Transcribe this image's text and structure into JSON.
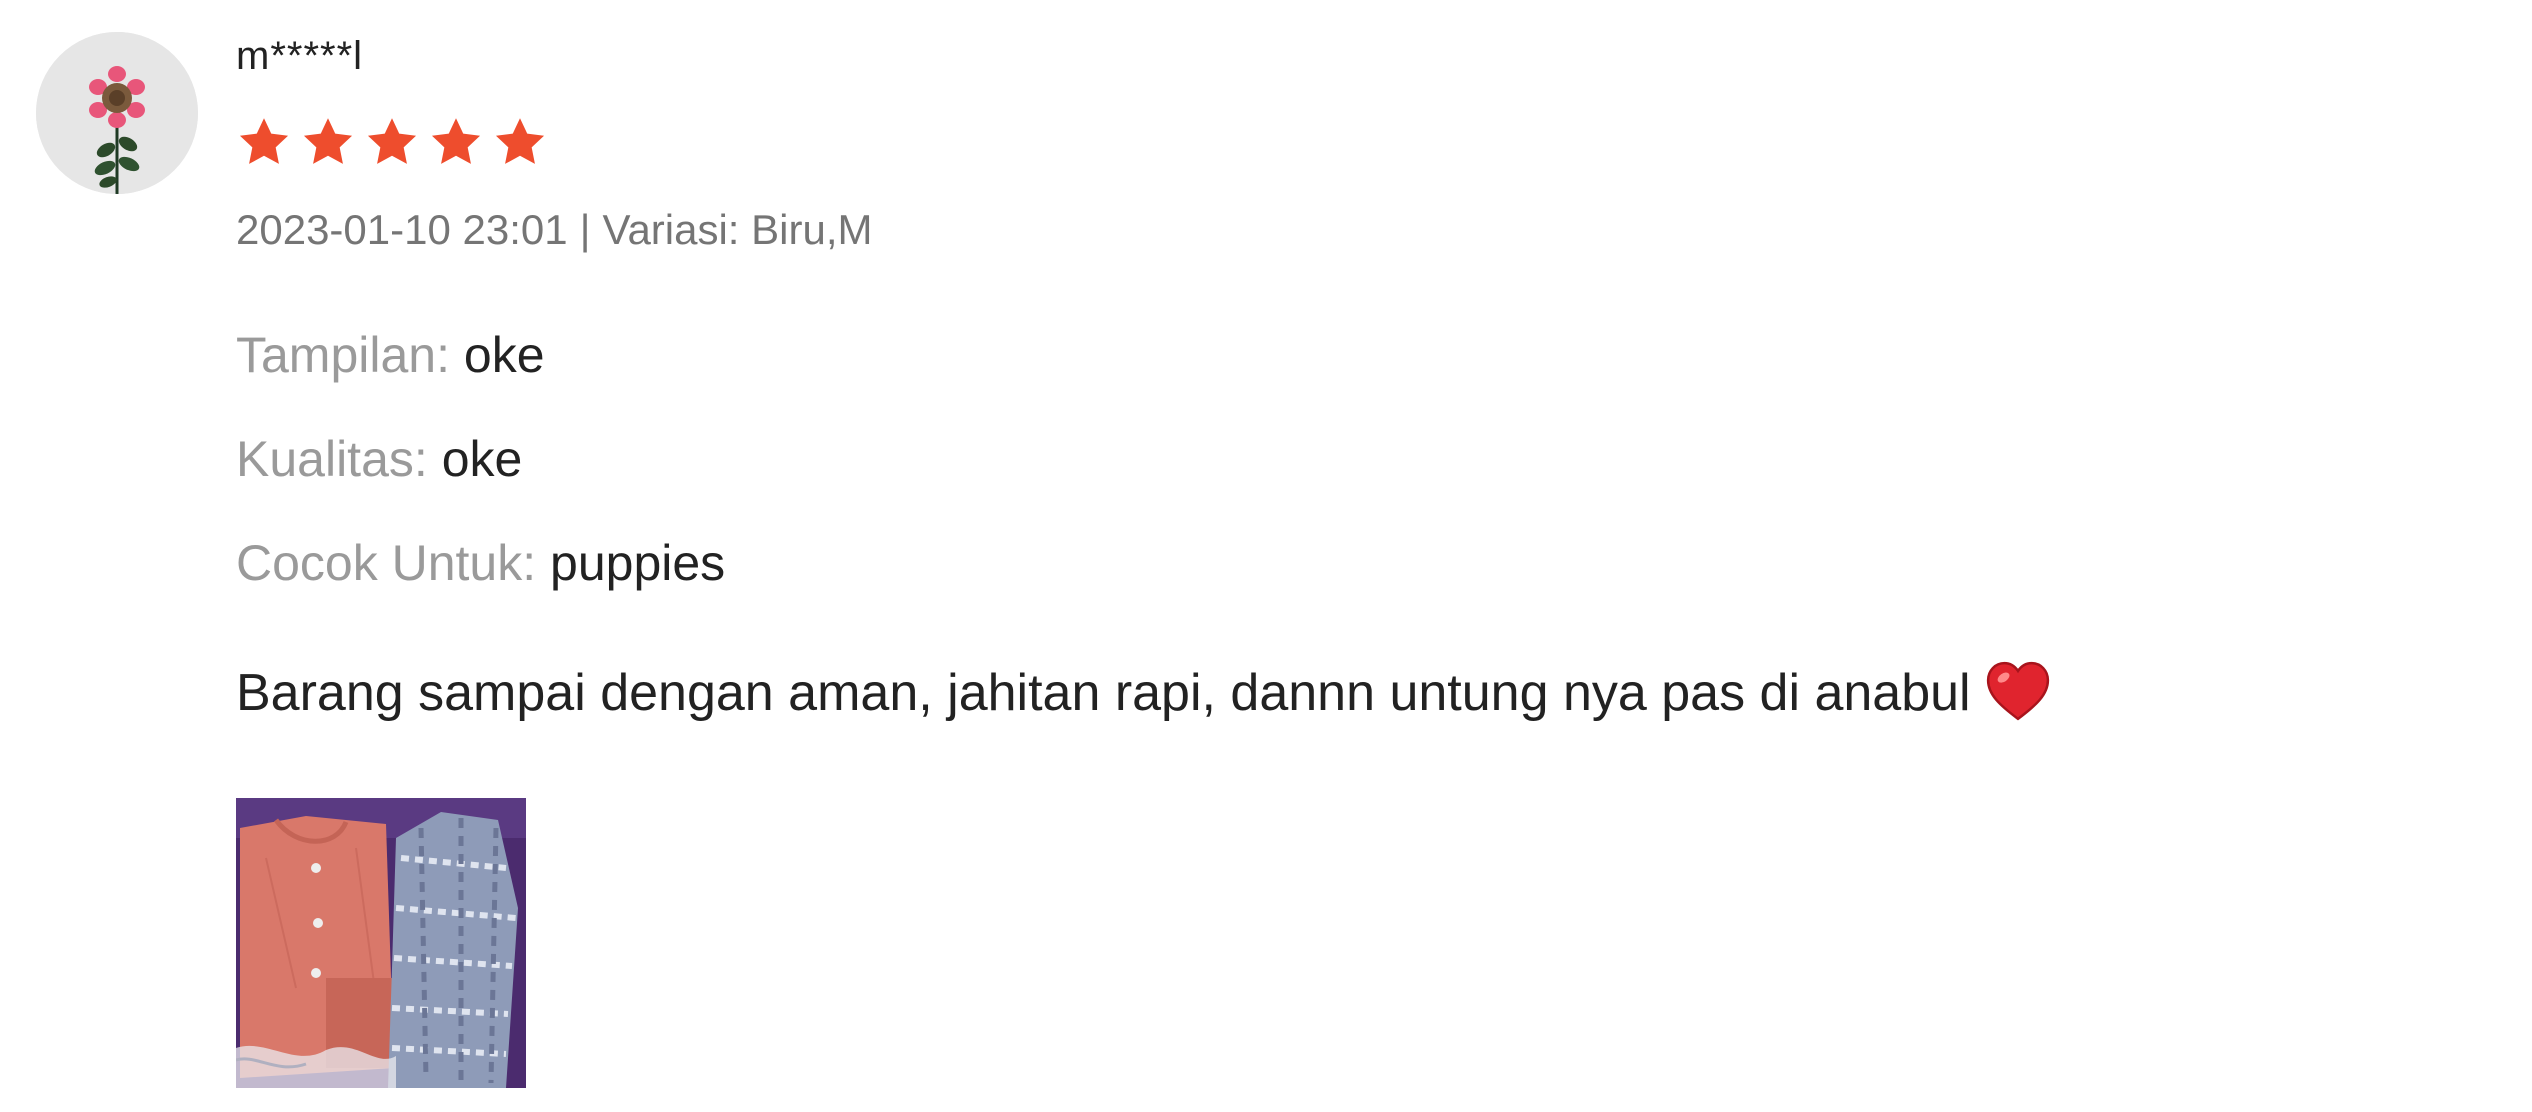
{
  "review": {
    "username": "m*****l",
    "rating": 5,
    "rating_max": 5,
    "datetime": "2023-01-10 23:01",
    "separator": "|",
    "variation_label": "Variasi:",
    "variation_value": "Biru,M",
    "attributes": [
      {
        "key": "Tampilan:",
        "value": "oke"
      },
      {
        "key": "Kualitas:",
        "value": "oke"
      },
      {
        "key": "Cocok Untuk:",
        "value": "puppies"
      }
    ],
    "comment": "Barang sampai dengan aman, jahitan rapi, dannn untung nya pas di anabul",
    "comment_emoji": "heart-emoji-icon",
    "star_color": "#ee4d2d",
    "photo_count": 1
  }
}
